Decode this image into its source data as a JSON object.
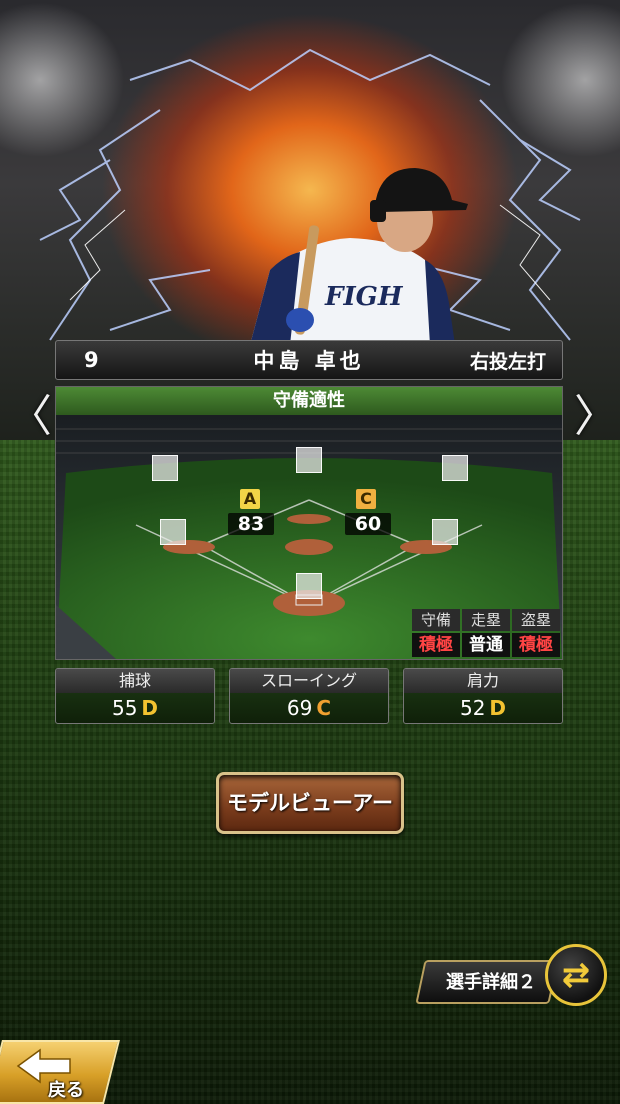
{
  "player": {
    "number": "9",
    "name": "中島 卓也",
    "handedness": "右投左打"
  },
  "nav": {
    "prev": "〈",
    "next": "〉"
  },
  "defense": {
    "title": "守備適性",
    "positions": [
      {
        "grade": "A",
        "value": "83",
        "grade_color": "#f2d447"
      },
      {
        "grade": "C",
        "value": "60",
        "grade_color": "#f0b040"
      }
    ],
    "traits": [
      {
        "label": "守備",
        "value": "積極",
        "color": "#ff4444"
      },
      {
        "label": "走塁",
        "value": "普通",
        "color": "#ffffff"
      },
      {
        "label": "盗塁",
        "value": "積極",
        "color": "#ff4444"
      }
    ]
  },
  "stats": [
    {
      "label": "捕球",
      "value": "55",
      "grade": "D",
      "grade_color": "#f2c230"
    },
    {
      "label": "スローイング",
      "value": "69",
      "grade": "C",
      "grade_color": "#f0a030"
    },
    {
      "label": "肩力",
      "value": "52",
      "grade": "D",
      "grade_color": "#f2c230"
    }
  ],
  "buttons": {
    "model_viewer": "モデルビューアー",
    "player_detail": "選手詳細２",
    "back": "戻る"
  },
  "colors": {
    "accent_gold": "#e8c43a",
    "header_green": "#4d8a35"
  }
}
